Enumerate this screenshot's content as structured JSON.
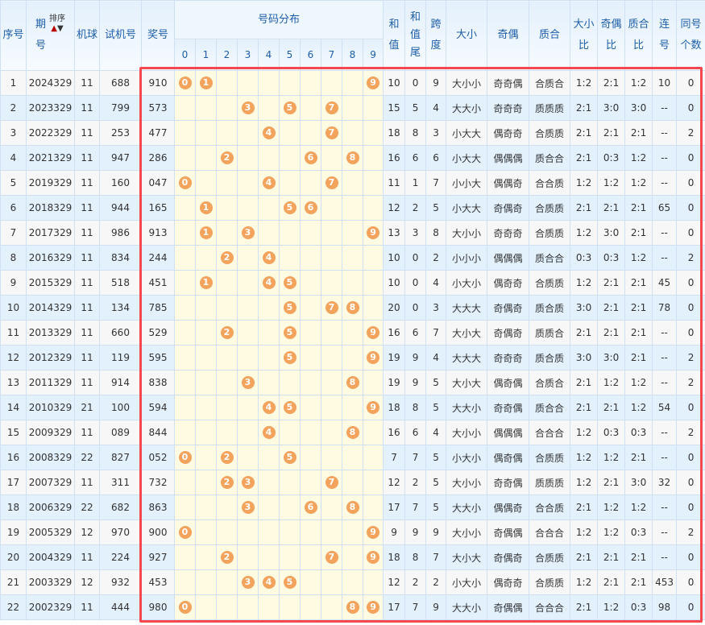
{
  "headers": {
    "seq": "序号",
    "period": "期\n号",
    "sort": "排序",
    "sort_up": "▲",
    "sort_down": "▼",
    "ball": "机球",
    "test": "试机号",
    "prize": "奖号",
    "dist": "号码分布",
    "digits": [
      "0",
      "1",
      "2",
      "3",
      "4",
      "5",
      "6",
      "7",
      "8",
      "9"
    ],
    "sum": "和\n值",
    "tail": "和\n值\n尾",
    "span": "跨\n度",
    "dx": "大小",
    "jo": "奇偶",
    "zh": "质合",
    "dxb": "大小\n比",
    "job": "奇偶\n比",
    "zhb": "质合\n比",
    "lian": "连\n号",
    "tong": "同号\n个数"
  },
  "colors": {
    "ball": "#f3a35c",
    "highlight": "#f5474f"
  },
  "rows": [
    [
      "1",
      "2024329",
      "11",
      "688",
      "910",
      "10",
      "0",
      "9",
      "大小小",
      "奇奇偶",
      "合质合",
      "1:2",
      "2:1",
      "1:2",
      "10",
      "0"
    ],
    [
      "2",
      "2023329",
      "11",
      "799",
      "573",
      "15",
      "5",
      "4",
      "大大小",
      "奇奇奇",
      "质质质",
      "2:1",
      "3:0",
      "3:0",
      "--",
      "0"
    ],
    [
      "3",
      "2022329",
      "11",
      "253",
      "477",
      "18",
      "8",
      "3",
      "小大大",
      "偶奇奇",
      "合质质",
      "2:1",
      "2:1",
      "2:1",
      "--",
      "2"
    ],
    [
      "4",
      "2021329",
      "11",
      "947",
      "286",
      "16",
      "6",
      "6",
      "小大大",
      "偶偶偶",
      "质合合",
      "2:1",
      "0:3",
      "1:2",
      "--",
      "0"
    ],
    [
      "5",
      "2019329",
      "11",
      "160",
      "047",
      "11",
      "1",
      "7",
      "小小大",
      "偶偶奇",
      "合合质",
      "1:2",
      "1:2",
      "1:2",
      "--",
      "0"
    ],
    [
      "6",
      "2018329",
      "11",
      "944",
      "165",
      "12",
      "2",
      "5",
      "小大大",
      "奇偶奇",
      "合质质",
      "2:1",
      "2:1",
      "2:1",
      "65",
      "0"
    ],
    [
      "7",
      "2017329",
      "11",
      "986",
      "913",
      "13",
      "3",
      "8",
      "大小小",
      "奇奇奇",
      "合质质",
      "1:2",
      "3:0",
      "2:1",
      "--",
      "0"
    ],
    [
      "8",
      "2016329",
      "11",
      "834",
      "244",
      "10",
      "0",
      "2",
      "小小小",
      "偶偶偶",
      "质合合",
      "0:3",
      "0:3",
      "1:2",
      "--",
      "2"
    ],
    [
      "9",
      "2015329",
      "11",
      "518",
      "451",
      "10",
      "0",
      "4",
      "小大小",
      "偶奇奇",
      "合质质",
      "1:2",
      "2:1",
      "2:1",
      "45",
      "0"
    ],
    [
      "10",
      "2014329",
      "11",
      "134",
      "785",
      "20",
      "0",
      "3",
      "大大大",
      "奇偶奇",
      "质合质",
      "3:0",
      "2:1",
      "2:1",
      "78",
      "0"
    ],
    [
      "11",
      "2013329",
      "11",
      "660",
      "529",
      "16",
      "6",
      "7",
      "大小大",
      "奇偶奇",
      "质质合",
      "2:1",
      "2:1",
      "2:1",
      "--",
      "0"
    ],
    [
      "12",
      "2012329",
      "11",
      "119",
      "595",
      "19",
      "9",
      "4",
      "大大大",
      "奇奇奇",
      "质合质",
      "3:0",
      "3:0",
      "2:1",
      "--",
      "2"
    ],
    [
      "13",
      "2011329",
      "11",
      "914",
      "838",
      "19",
      "9",
      "5",
      "大小大",
      "偶奇偶",
      "合质合",
      "2:1",
      "1:2",
      "1:2",
      "--",
      "2"
    ],
    [
      "14",
      "2010329",
      "21",
      "100",
      "594",
      "18",
      "8",
      "5",
      "大大小",
      "奇奇偶",
      "质合合",
      "2:1",
      "2:1",
      "1:2",
      "54",
      "0"
    ],
    [
      "15",
      "2009329",
      "11",
      "089",
      "844",
      "16",
      "6",
      "4",
      "大小小",
      "偶偶偶",
      "合合合",
      "1:2",
      "0:3",
      "0:3",
      "--",
      "2"
    ],
    [
      "16",
      "2008329",
      "22",
      "827",
      "052",
      "7",
      "7",
      "5",
      "小大小",
      "偶奇偶",
      "合质质",
      "1:2",
      "1:2",
      "2:1",
      "--",
      "0"
    ],
    [
      "17",
      "2007329",
      "11",
      "311",
      "732",
      "12",
      "2",
      "5",
      "大小小",
      "奇奇偶",
      "质质质",
      "1:2",
      "2:1",
      "3:0",
      "32",
      "0"
    ],
    [
      "18",
      "2006329",
      "22",
      "682",
      "863",
      "17",
      "7",
      "5",
      "大大小",
      "偶偶奇",
      "合合质",
      "2:1",
      "1:2",
      "1:2",
      "--",
      "0"
    ],
    [
      "19",
      "2005329",
      "12",
      "970",
      "900",
      "9",
      "9",
      "9",
      "大小小",
      "奇偶偶",
      "合合合",
      "1:2",
      "1:2",
      "0:3",
      "--",
      "2"
    ],
    [
      "20",
      "2004329",
      "11",
      "224",
      "927",
      "18",
      "8",
      "7",
      "大小大",
      "奇偶奇",
      "合质质",
      "2:1",
      "2:1",
      "2:1",
      "--",
      "0"
    ],
    [
      "21",
      "2003329",
      "12",
      "932",
      "453",
      "12",
      "2",
      "2",
      "小大小",
      "偶奇奇",
      "合质质",
      "1:2",
      "2:1",
      "2:1",
      "453",
      "0"
    ],
    [
      "22",
      "2002329",
      "11",
      "444",
      "980",
      "17",
      "7",
      "9",
      "大大小",
      "奇偶偶",
      "合合合",
      "2:1",
      "1:2",
      "0:3",
      "98",
      "0"
    ]
  ]
}
